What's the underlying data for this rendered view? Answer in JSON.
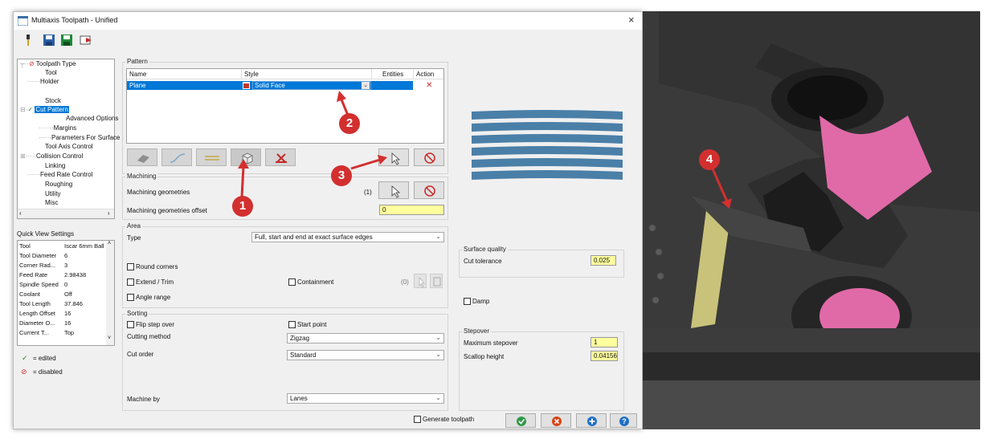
{
  "window": {
    "title": "Multiaxis Toolpath - Unified",
    "close": "×"
  },
  "toolbar": {
    "icons": [
      "tool-icon",
      "save-icon",
      "save-as-icon",
      "export-icon"
    ]
  },
  "tree": {
    "items": [
      "Toolpath Type",
      "Tool",
      "Holder",
      "Stock",
      "Cut Pattern",
      "Advanced Options",
      "Margins",
      "Parameters For Surface",
      "Tool Axis Control",
      "Collision Control",
      "Linking",
      "Feed Rate Control",
      "Roughing",
      "Utility",
      "Misc"
    ],
    "check_mark": "✓",
    "disabled_mark": "⊘"
  },
  "quick_view": {
    "title": "Quick View Settings",
    "rows": [
      [
        "Tool",
        "Iscar 6mm Ball"
      ],
      [
        "Tool Diameter",
        "6"
      ],
      [
        "Corner Rad...",
        "3"
      ],
      [
        "Feed Rate",
        "2.98438"
      ],
      [
        "Spindle Speed",
        "0"
      ],
      [
        "Coolant",
        "Off"
      ],
      [
        "Tool Length",
        "37.846"
      ],
      [
        "Length Offset",
        "16"
      ],
      [
        "Diameter O...",
        "16"
      ],
      [
        "Current T...",
        "Top"
      ]
    ],
    "legend": {
      "edited": "= edited",
      "disabled": "= disabled"
    }
  },
  "pattern": {
    "group_label": "Pattern",
    "columns": [
      "Name",
      "Style",
      "Entities",
      "Action"
    ],
    "row": {
      "name": "Plane",
      "style": "Solid Face",
      "entities": "",
      "action": "✕"
    }
  },
  "machining": {
    "group_label": "Machining",
    "geometries_label": "Machining geometries",
    "geometries_count": "(1)",
    "offset_label": "Machining geometries offset",
    "offset_value": "0"
  },
  "area": {
    "group_label": "Area",
    "type_label": "Type",
    "type_value": "Full, start and end at exact surface edges",
    "round_corners": "Round corners",
    "extend_trim": "Extend / Trim",
    "containment": "Containment",
    "containment_count": "(0)",
    "angle_range": "Angle range"
  },
  "sorting": {
    "group_label": "Sorting",
    "flip_step": "Flip step over",
    "start_point": "Start point",
    "cutting_method_label": "Cutting method",
    "cutting_method_value": "Zigzag",
    "cut_order_label": "Cut order",
    "cut_order_value": "Standard",
    "machine_by_label": "Machine by",
    "machine_by_value": "Lanes"
  },
  "surface_quality": {
    "group_label": "Surface quality",
    "cut_tolerance_label": "Cut tolerance",
    "cut_tolerance_value": "0.025"
  },
  "damp": "Damp",
  "stepover": {
    "group_label": "Stepover",
    "max_label": "Maximum stepover",
    "max_value": "1",
    "scallop_label": "Scallop height",
    "scallop_value": "0.04156"
  },
  "footer": {
    "generate": "Generate toolpath"
  },
  "markers": [
    "1",
    "2",
    "3",
    "4"
  ],
  "colors": {
    "accent": "#0078d7",
    "marker": "#d32f2f",
    "preview_stripe": "#4a7fa8",
    "highlight_face": "#e06aa8",
    "selected_strip": "#c9c27a"
  }
}
